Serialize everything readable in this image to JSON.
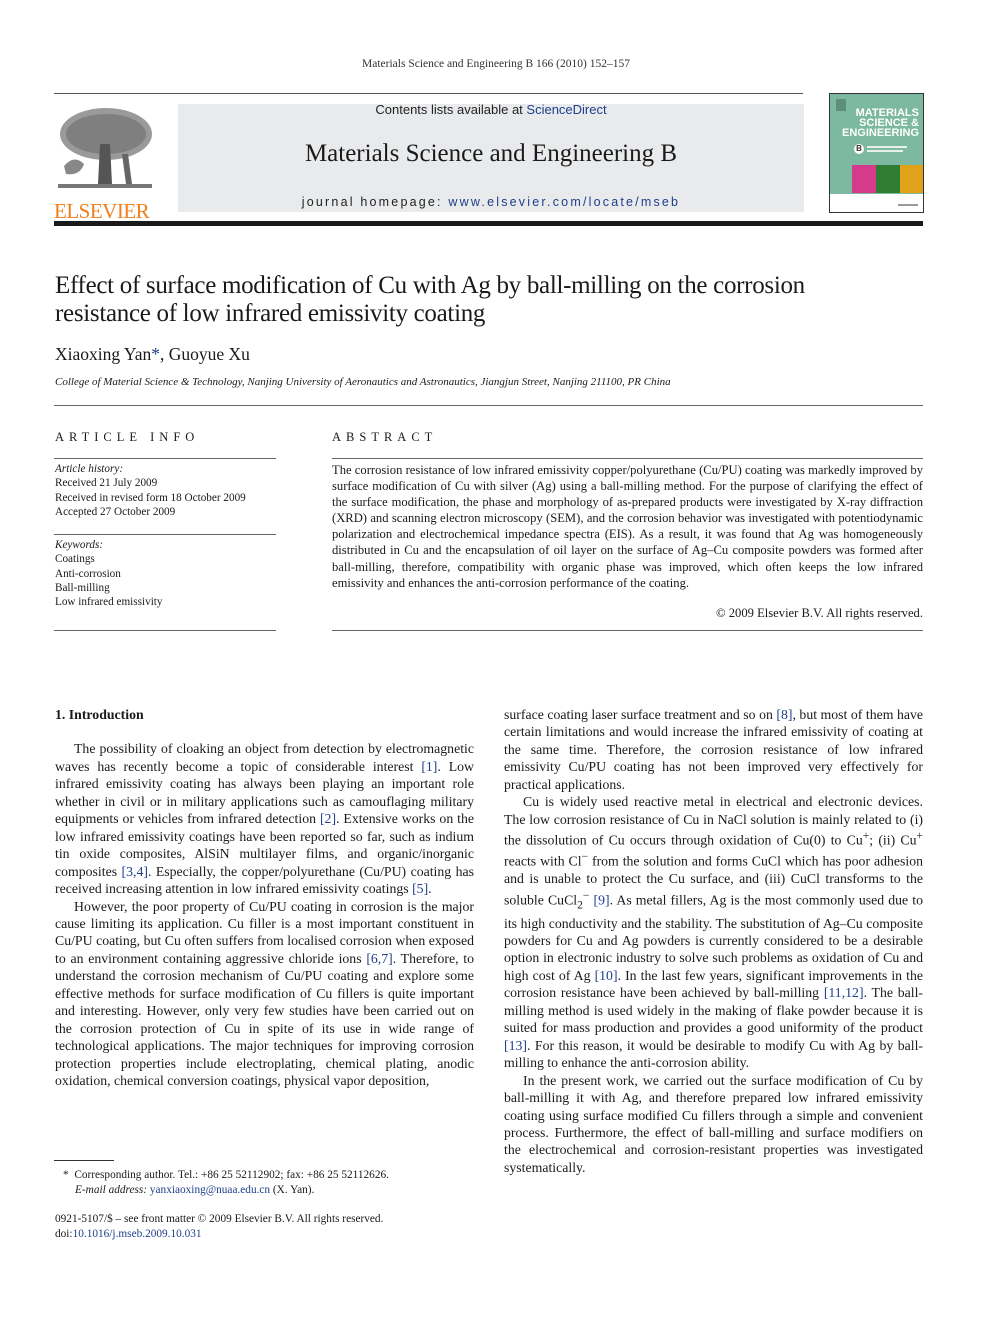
{
  "running_head": "Materials Science and Engineering B 166 (2010) 152–157",
  "banner": {
    "contents_prefix": "Contents lists available at ",
    "contents_link": "ScienceDirect",
    "journal_name": "Materials Science and Engineering B",
    "homepage_label": "journal homepage: ",
    "homepage_url": "www.elsevier.com/locate/mseb"
  },
  "publisher_logo": {
    "text": "ELSEVIER",
    "color": "#f07f1b",
    "icon": "elsevier-tree-logo"
  },
  "cover": {
    "line1": "MATERIALS",
    "line2": "SCIENCE &",
    "line3": "ENGINEERING",
    "badge": "B",
    "colors": {
      "background": "#7cb9a0",
      "panel1": "#d63a8a",
      "panel2": "#2e7d32",
      "panel3": "#e0a21a"
    }
  },
  "article": {
    "title_line1": "Effect of surface modification of Cu with Ag by ball-milling on the corrosion",
    "title_line2": "resistance of low infrared emissivity coating",
    "author1": "Xiaoxing Yan",
    "author1_mark": "*",
    "author2": ", Guoyue Xu",
    "affiliation": "College of Material Science & Technology, Nanjing University of Aeronautics and Astronautics, Jiangjun Street, Nanjing 211100, PR China"
  },
  "article_info": {
    "heading": "ARTICLE INFO",
    "history_label": "Article history:",
    "history": [
      "Received 21 July 2009",
      "Received in revised form 18 October 2009",
      "Accepted 27 October 2009"
    ],
    "keywords_label": "Keywords:",
    "keywords": [
      "Coatings",
      "Anti-corrosion",
      "Ball-milling",
      "Low infrared emissivity"
    ]
  },
  "abstract": {
    "heading": "ABSTRACT",
    "text": "The corrosion resistance of low infrared emissivity copper/polyurethane (Cu/PU) coating was markedly improved by surface modification of Cu with silver (Ag) using a ball-milling method. For the purpose of clarifying the effect of the surface modification, the phase and morphology of as-prepared products were investigated by X-ray diffraction (XRD) and scanning electron microscopy (SEM), and the corrosion behavior was investigated with potentiodynamic polarization and electrochemical impedance spectra (EIS). As a result, it was found that Ag was homogeneously distributed in Cu and the encapsulation of oil layer on the surface of Ag–Cu composite powders was formed after ball-milling, therefore, compatibility with organic phase was improved, which often keeps the low infrared emissivity and enhances the anti-corrosion performance of the coating.",
    "copyright": "© 2009 Elsevier B.V. All rights reserved."
  },
  "body": {
    "section_heading": "1.  Introduction",
    "left_p1": [
      "The possibility of cloaking an object from detection by electromagnetic waves has recently become a topic of considerable interest ",
      "[1]",
      ". Low infrared emissivity coating has always been playing an important role whether in civil or in military applications such as camouflaging military equipments or vehicles from infrared detection ",
      "[2]",
      ". Extensive works on the low infrared emissivity coatings have been reported so far, such as indium tin oxide composites, AlSiN multilayer films, and organic/inorganic composites ",
      "[3,4]",
      ". Especially, the copper/polyurethane (Cu/PU) coating has received increasing attention in low infrared emissivity coatings ",
      "[5]",
      "."
    ],
    "left_p2": [
      "However, the poor property of Cu/PU coating in corrosion is the major cause limiting its application. Cu filler is a most important constituent in Cu/PU coating, but Cu often suffers from localised corrosion when exposed to an environment containing aggressive chloride ions ",
      "[6,7]",
      ". Therefore, to understand the corrosion mechanism of Cu/PU coating and explore some effective methods for surface modification of Cu fillers is quite important and interesting. However, only very few studies have been carried out on the corrosion protection of Cu in spite of its use in wide range of technological applications. The major techniques for improving corrosion protection properties include electroplating, chemical plating, anodic oxidation, chemical conversion coatings, physical vapor deposition,"
    ],
    "right_p1": [
      "surface coating laser surface treatment and so on ",
      "[8]",
      ", but most of them have certain limitations and would increase the infrared emissivity of coating at the same time. Therefore, the corrosion resistance of low infrared emissivity Cu/PU coating has not been improved very effectively for practical applications."
    ],
    "right_p2": [
      "Cu is widely used reactive metal in electrical and electronic devices. The low corrosion resistance of Cu in NaCl solution is mainly related to (i) the dissolution of Cu occurs through oxidation of Cu(0) to Cu",
      "+",
      "; (ii) Cu",
      "+",
      " reacts with Cl",
      "−",
      " from the solution and forms CuCl which has poor adhesion and is unable to protect the Cu surface, and (iii) CuCl transforms to the soluble CuCl",
      "2",
      "−",
      " ",
      "[9]",
      ". As metal fillers, Ag is the most commonly used due to its high conductivity and the stability. The substitution of Ag–Cu composite powders for Cu and Ag powders is currently considered to be a desirable option in electronic industry to solve such problems as oxidation of Cu and high cost of Ag ",
      "[10]",
      ". In the last few years, significant improvements in the corrosion resistance have been achieved by ball-milling ",
      "[11,12]",
      ". The ball-milling method is used widely in the making of flake powder because it is suited for mass production and provides a good uniformity of the product ",
      "[13]",
      ". For this reason, it would be desirable to modify Cu with Ag by ball-milling to enhance the anti-corrosion ability."
    ],
    "right_p3": "In the present work, we carried out the surface modification of Cu by ball-milling it with Ag, and therefore prepared low infrared emissivity coating using surface modified Cu fillers through a simple and convenient process. Furthermore, the effect of ball-milling and surface modifiers on the electrochemical and corrosion-resistant properties was investigated systematically."
  },
  "footnote": {
    "mark": "*",
    "corresponding": "Corresponding author. Tel.: +86 25 52112902; fax: +86 25 52112626.",
    "email_label": "E-mail address: ",
    "email": "yanxiaoxing@nuaa.edu.cn",
    "email_suffix": " (X. Yan).",
    "front_matter": "0921-5107/$ – see front matter © 2009 Elsevier B.V. All rights reserved.",
    "doi_label": "doi:",
    "doi": "10.1016/j.mseb.2009.10.031"
  }
}
